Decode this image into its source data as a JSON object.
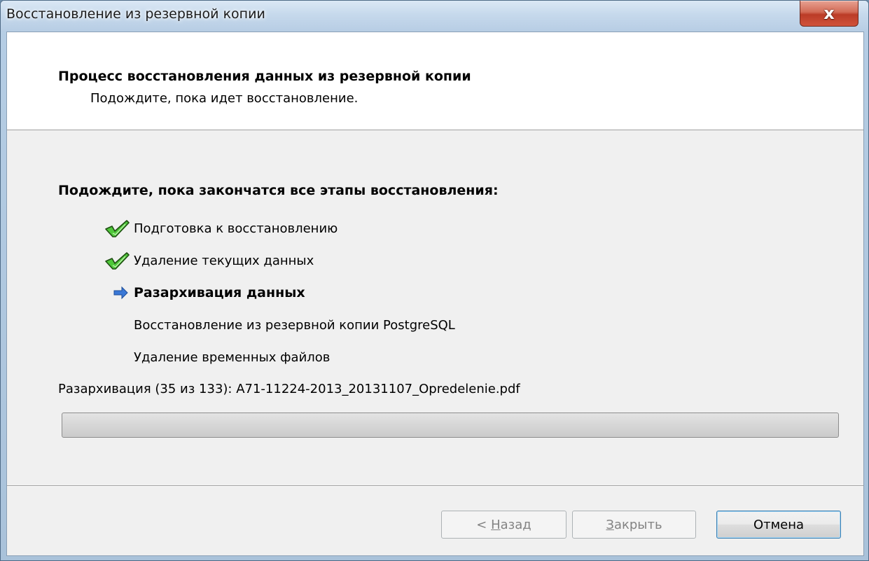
{
  "window": {
    "title": "Восстановление из резервной копии",
    "close_label": "x"
  },
  "header": {
    "title": "Процесс восстановления данных из резервной копии",
    "subtitle": "Подождите, пока идет восстановление."
  },
  "steps_heading": "Подождите, пока закончатся все этапы восстановления:",
  "steps": [
    {
      "label": "Подготовка к восстановлению",
      "state": "done",
      "icon": "checkmark-icon"
    },
    {
      "label": "Удаление текущих данных",
      "state": "done",
      "icon": "checkmark-icon"
    },
    {
      "label": "Разархивация данных",
      "state": "current",
      "icon": "arrow-right-icon"
    },
    {
      "label": "Восстановление из резервной копии PostgreSQL",
      "state": "pending",
      "icon": ""
    },
    {
      "label": "Удаление временных файлов",
      "state": "pending",
      "icon": ""
    }
  ],
  "status": "Разархивация (35 из 133): A71-11224-2013_20131107_Opredelenie.pdf",
  "progress": {
    "fraction": 0
  },
  "buttons": {
    "back": {
      "prefix": "< ",
      "accel": "Н",
      "rest": "азад",
      "enabled": false
    },
    "close": {
      "accel": "З",
      "rest": "акрыть",
      "enabled": false
    },
    "cancel": {
      "label": "Отмена",
      "enabled": true
    }
  },
  "colors": {
    "check_fill": "#4fc83a",
    "check_stroke": "#1f4f12",
    "arrow": "#3a78d6"
  }
}
